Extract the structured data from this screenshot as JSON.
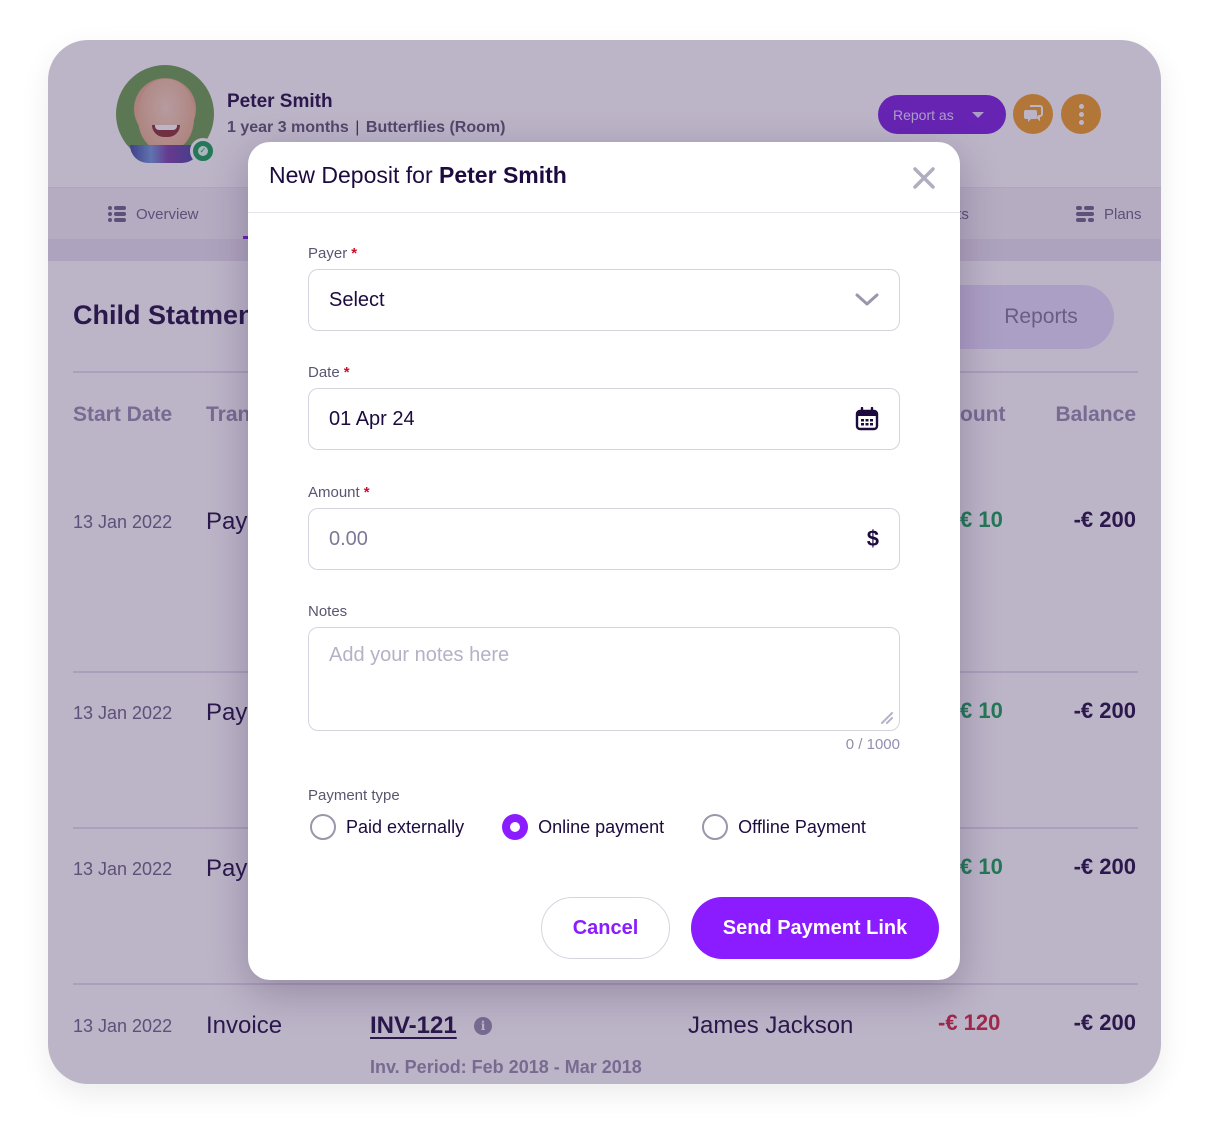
{
  "profile": {
    "name": "Peter Smith",
    "age": "1 year 3 months",
    "separator": "|",
    "room": "Butterflies (Room)",
    "status": "active"
  },
  "header_actions": {
    "report_as_label": "Report as",
    "chat_icon": "chat-bubbles-icon",
    "more_icon": "more-vertical-icon"
  },
  "tabs": [
    {
      "label": "Overview",
      "icon": "list-icon"
    },
    {
      "label": "ments",
      "icon": ""
    },
    {
      "label": "Plans",
      "icon": "plans-icon"
    }
  ],
  "statement": {
    "title": "Child Statmen",
    "reports_label": "Reports",
    "columns": [
      "Start Date",
      "Tran",
      "ount",
      "Balance"
    ],
    "rows": [
      {
        "date": "13 Jan 2022",
        "type": "Pay",
        "amount": "€ 10",
        "balance": "-€ 200"
      },
      {
        "date": "13 Jan 2022",
        "type": "Pay",
        "amount": "€ 10",
        "balance": "-€ 200"
      },
      {
        "date": "13 Jan 2022",
        "type": "Pay",
        "amount": "€ 10",
        "balance": "-€ 200"
      },
      {
        "date": "13 Jan 2022",
        "type": "Invoice",
        "reference": "INV-121",
        "period": "Inv. Period: Feb 2018 - Mar 2018",
        "payer": "James Jackson",
        "amount": "-€ 120",
        "balance": "-€ 200"
      }
    ]
  },
  "colors": {
    "accent": "#8a1cff",
    "positive": "#12a150",
    "negative": "#d0243e",
    "required": "#c8102e"
  },
  "modal": {
    "title_prefix": "New Deposit for ",
    "title_name": "Peter Smith",
    "payer": {
      "label": "Payer",
      "required": "*",
      "value": "Select"
    },
    "date": {
      "label": "Date",
      "required": "*",
      "value": "01 Apr 24"
    },
    "amount": {
      "label": "Amount",
      "required": "*",
      "placeholder": "0.00",
      "currency": "$"
    },
    "notes": {
      "label": "Notes",
      "placeholder": "Add your notes here",
      "counter": "0 / 1000"
    },
    "payment_type": {
      "label": "Payment type",
      "options": [
        {
          "label": "Paid externally",
          "selected": false
        },
        {
          "label": "Online payment",
          "selected": true
        },
        {
          "label": "Offline Payment",
          "selected": false
        }
      ]
    },
    "cancel_label": "Cancel",
    "submit_label": "Send Payment Link"
  }
}
